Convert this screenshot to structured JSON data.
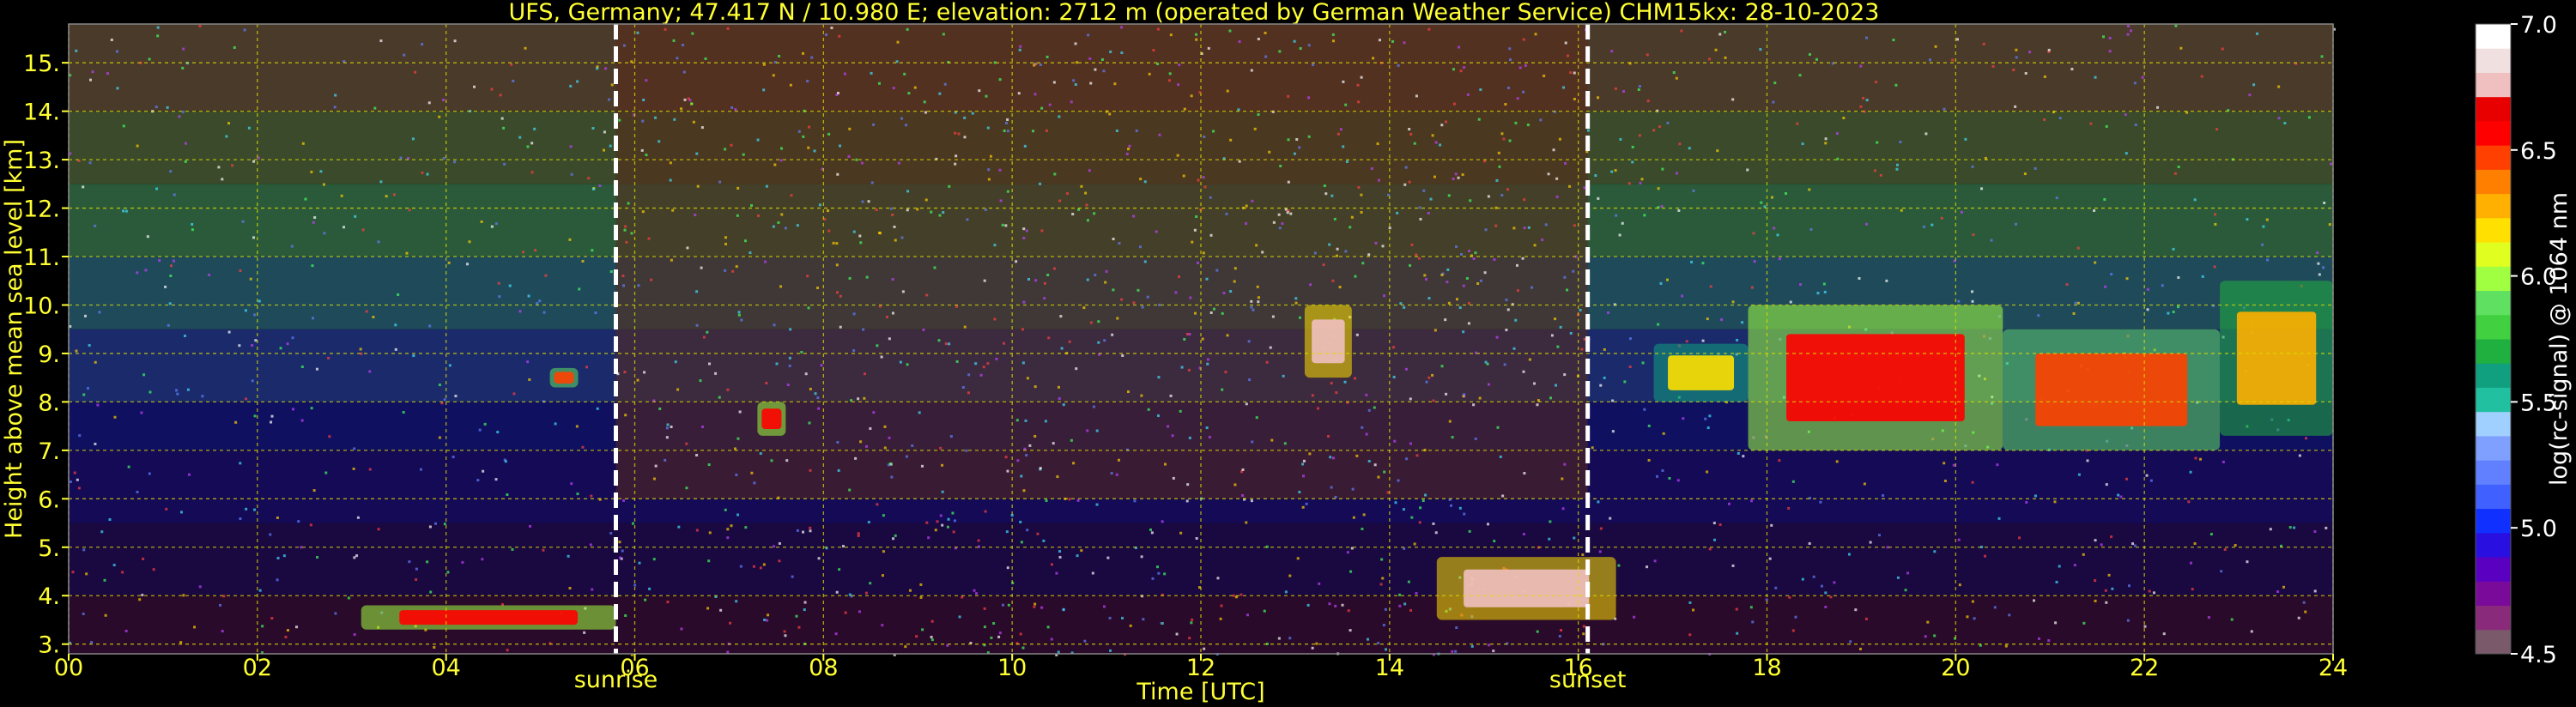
{
  "chart_data": {
    "type": "heatmap",
    "title": "UFS, Germany; 47.417 N / 10.980 E; elevation: 2712 m  (operated by German Weather Service)    CHM15kx: 28-10-2023",
    "xlabel": "Time [UTC]",
    "ylabel": "Height above mean sea level [km]",
    "xlim": [
      0,
      24
    ],
    "ylim": [
      2.8,
      15.8
    ],
    "x_ticks": [
      0,
      2,
      4,
      6,
      8,
      10,
      12,
      14,
      16,
      18,
      20,
      22,
      24
    ],
    "x_tick_labels": [
      "00",
      "02",
      "04",
      "06",
      "08",
      "10",
      "12",
      "14",
      "16",
      "18",
      "20",
      "22",
      "24"
    ],
    "y_ticks": [
      3,
      4,
      5,
      6,
      7,
      8,
      9,
      10,
      11,
      12,
      13,
      14,
      15
    ],
    "y_tick_labels": [
      "3.",
      "4.",
      "5.",
      "6.",
      "7.",
      "8.",
      "9.",
      "10.",
      "11.",
      "12.",
      "13.",
      "14.",
      "15."
    ],
    "grid": true,
    "markers": [
      {
        "label": "sunrise",
        "x": 5.8
      },
      {
        "label": "sunset",
        "x": 16.1
      }
    ],
    "colorbar": {
      "label": "log(rc-signal) @ 1064 nm",
      "range": [
        4.5,
        7.0
      ],
      "ticks": [
        4.5,
        5.0,
        5.5,
        6.0,
        6.5,
        7.0
      ],
      "tick_labels": [
        "4.5",
        "5.0",
        "5.5",
        "6.0",
        "6.5",
        "7.0"
      ],
      "colors": [
        "#7a5a6a",
        "#8a2a7a",
        "#7a0a9a",
        "#5a00c0",
        "#2a10e0",
        "#1030ff",
        "#4060ff",
        "#6080ff",
        "#80a0ff",
        "#a0d0ff",
        "#20c0a0",
        "#10a080",
        "#20b040",
        "#40d040",
        "#60e060",
        "#a0ff40",
        "#e0ff20",
        "#ffe000",
        "#ffb000",
        "#ff8000",
        "#ff4000",
        "#ff0000",
        "#e80000",
        "#f0c0c0",
        "#f0e0e0",
        "#ffffff"
      ]
    },
    "features": [
      {
        "name": "cloud",
        "t0": 20.5,
        "t1": 22.8,
        "h0": 7.0,
        "h1": 9.5,
        "level": 6.5
      },
      {
        "name": "cloud",
        "t0": 17.8,
        "t1": 20.5,
        "h0": 7.0,
        "h1": 10.0,
        "level": 6.6
      },
      {
        "name": "cloud",
        "t0": 16.8,
        "t1": 17.8,
        "h0": 8.0,
        "h1": 9.2,
        "level": 6.2
      },
      {
        "name": "cloud",
        "t0": 22.8,
        "t1": 24.0,
        "h0": 7.3,
        "h1": 10.5,
        "level": 6.3
      },
      {
        "name": "low-layer",
        "t0": 14.5,
        "t1": 16.4,
        "h0": 3.5,
        "h1": 4.8,
        "level": 6.8
      },
      {
        "name": "low-layer",
        "t0": 3.1,
        "t1": 5.8,
        "h0": 3.3,
        "h1": 3.8,
        "level": 6.6
      },
      {
        "name": "cloud",
        "t0": 5.1,
        "t1": 5.4,
        "h0": 8.3,
        "h1": 8.7,
        "level": 6.5
      },
      {
        "name": "cloud",
        "t0": 7.3,
        "t1": 7.6,
        "h0": 7.3,
        "h1": 8.0,
        "level": 6.6
      },
      {
        "name": "cloud",
        "t0": 13.1,
        "t1": 13.6,
        "h0": 8.5,
        "h1": 10.0,
        "level": 6.8
      }
    ]
  }
}
